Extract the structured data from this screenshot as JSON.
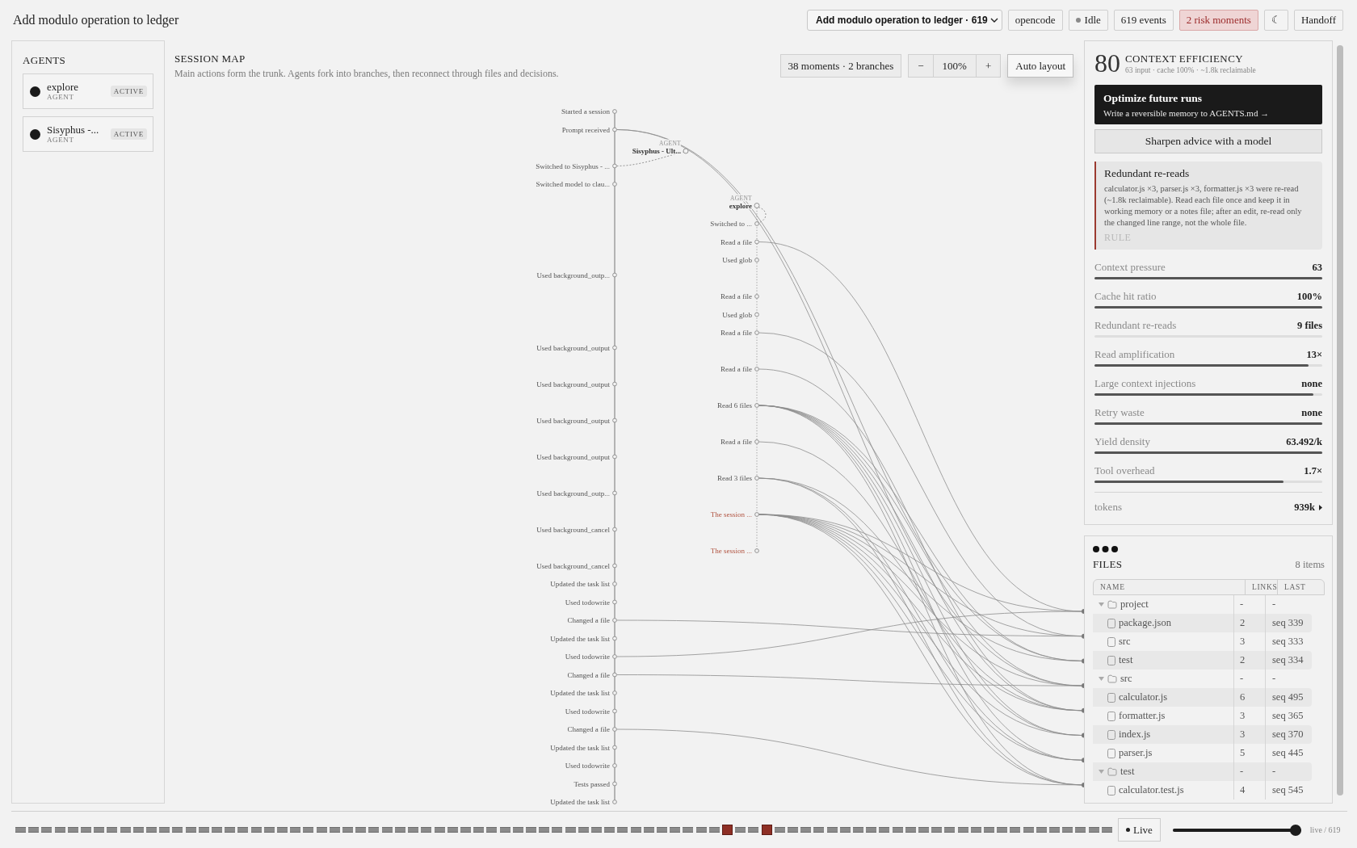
{
  "header": {
    "title": "Add modulo operation to ledger",
    "session_select": "Add modulo operation to ledger · 619",
    "buttons": [
      {
        "label": "opencode",
        "kind": "plain"
      },
      {
        "label": "Idle",
        "kind": "status"
      },
      {
        "label": "619 events",
        "kind": "plain"
      },
      {
        "label": "2 risk moments",
        "kind": "alert"
      },
      {
        "label": "☾",
        "kind": "plain"
      },
      {
        "label": "Handoff",
        "kind": "plain"
      }
    ]
  },
  "agents": {
    "title": "AGENTS",
    "items": [
      {
        "name": "explore",
        "role": "AGENT",
        "status": "ACTIVE"
      },
      {
        "name": "Sisyphus -...",
        "role": "AGENT",
        "status": "ACTIVE"
      }
    ]
  },
  "session_map": {
    "title": "SESSION MAP",
    "subtitle": "Main actions form the trunk. Agents fork into branches, then reconnect through files and decisions.",
    "summary": "38 moments · 2 branches",
    "zoom_out": "−",
    "zoom": "100%",
    "zoom_in": "+",
    "auto_layout": "Auto layout",
    "moments": [
      {
        "label": "Started a session",
        "kind": "step"
      },
      {
        "label": "Prompt received",
        "kind": "step"
      },
      {
        "label": "Sisyphus - Ult...",
        "kind": "agent",
        "caption": "AGENT"
      },
      {
        "label": "Switched to Sisyphus - ...",
        "kind": "step"
      },
      {
        "label": "Switched model to clau...",
        "kind": "step"
      },
      {
        "label": "explore",
        "kind": "agent",
        "caption": "AGENT"
      },
      {
        "label": "Switched to ...",
        "kind": "branch"
      },
      {
        "label": "Read a file",
        "kind": "branch"
      },
      {
        "label": "Used glob",
        "kind": "branch"
      },
      {
        "label": "Used background_outp...",
        "kind": "step"
      },
      {
        "label": "Read a file",
        "kind": "branch"
      },
      {
        "label": "Used glob",
        "kind": "branch"
      },
      {
        "label": "Read a file",
        "kind": "branch"
      },
      {
        "label": "Used background_output",
        "kind": "step"
      },
      {
        "label": "Read a file",
        "kind": "branch"
      },
      {
        "label": "Used background_output",
        "kind": "step"
      },
      {
        "label": "Read 6 files",
        "kind": "branch"
      },
      {
        "label": "Used background_output",
        "kind": "step"
      },
      {
        "label": "Read a file",
        "kind": "branch"
      },
      {
        "label": "Used background_output",
        "kind": "step"
      },
      {
        "label": "Read 3 files",
        "kind": "branch"
      },
      {
        "label": "Used background_outp...",
        "kind": "step"
      },
      {
        "label": "The session ...",
        "kind": "branch_alert"
      },
      {
        "label": "Used background_cancel",
        "kind": "step"
      },
      {
        "label": "The session ...",
        "kind": "branch_alert"
      },
      {
        "label": "Used background_cancel",
        "kind": "step"
      },
      {
        "label": "Updated the task list",
        "kind": "step"
      },
      {
        "label": "Used todowrite",
        "kind": "step"
      },
      {
        "label": "Changed a file",
        "kind": "step"
      },
      {
        "label": "Updated the task list",
        "kind": "step"
      },
      {
        "label": "Used todowrite",
        "kind": "step"
      },
      {
        "label": "Changed a file",
        "kind": "step"
      },
      {
        "label": "Updated the task list",
        "kind": "step"
      },
      {
        "label": "Used todowrite",
        "kind": "step"
      },
      {
        "label": "Changed a file",
        "kind": "step"
      },
      {
        "label": "Updated the task list",
        "kind": "step"
      },
      {
        "label": "Used todowrite",
        "kind": "step"
      },
      {
        "label": "Tests passed",
        "kind": "step"
      },
      {
        "label": "Updated the task list",
        "kind": "step"
      }
    ]
  },
  "context_efficiency": {
    "score": "80",
    "title": "CONTEXT EFFICIENCY",
    "summary": "63 input · cache 100% · ~1.8k reclaimable",
    "action": {
      "title": "Optimize future runs",
      "subtitle": "Write a reversible memory to AGENTS.md →"
    },
    "advice_button": "Sharpen advice with a model",
    "finding": {
      "title": "Redundant re-reads",
      "body": "calculator.js ×3, parser.js ×3, formatter.js ×3 were re-read (~1.8k reclaimable). Read each file once and keep it in working memory or a notes file; after an edit, re-read only the changed line range, not the whole file.",
      "tag": "RULE"
    },
    "metrics": [
      {
        "label": "Context pressure",
        "value": "63",
        "level": 1
      },
      {
        "label": "Cache hit ratio",
        "value": "100%",
        "level": 1
      },
      {
        "label": "Redundant re-reads",
        "value": "9 files",
        "level": 0
      },
      {
        "label": "Read amplification",
        "value": "13×",
        "level": 0.94
      },
      {
        "label": "Large context injections",
        "value": "none",
        "level": 0.96
      },
      {
        "label": "Retry waste",
        "value": "none",
        "level": 1
      },
      {
        "label": "Yield density",
        "value": "63.492/k",
        "level": 1
      },
      {
        "label": "Tool overhead",
        "value": "1.7×",
        "level": 0.83
      }
    ],
    "tokens": {
      "label": "tokens",
      "value": "939k"
    }
  },
  "files": {
    "title": "FILES",
    "count": "8 items",
    "columns": [
      "NAME",
      "LINKS",
      "LAST"
    ],
    "tree": [
      {
        "name": "project",
        "kind": "folder",
        "expanded": true,
        "links": "-",
        "last": "-",
        "children": [
          {
            "name": "package.json",
            "kind": "file",
            "links": "2",
            "last": "seq 339"
          },
          {
            "name": "src",
            "kind": "file",
            "links": "3",
            "last": "seq 333"
          },
          {
            "name": "test",
            "kind": "file",
            "links": "2",
            "last": "seq 334"
          }
        ]
      },
      {
        "name": "src",
        "kind": "folder",
        "expanded": true,
        "links": "-",
        "last": "-",
        "children": [
          {
            "name": "calculator.js",
            "kind": "file",
            "links": "6",
            "last": "seq 495"
          },
          {
            "name": "formatter.js",
            "kind": "file",
            "links": "3",
            "last": "seq 365"
          },
          {
            "name": "index.js",
            "kind": "file",
            "links": "3",
            "last": "seq 370"
          },
          {
            "name": "parser.js",
            "kind": "file",
            "links": "5",
            "last": "seq 445"
          }
        ]
      },
      {
        "name": "test",
        "kind": "folder",
        "expanded": true,
        "links": "-",
        "last": "-",
        "children": [
          {
            "name": "calculator.test.js",
            "kind": "file",
            "links": "4",
            "last": "seq 545"
          }
        ]
      }
    ]
  },
  "timeline": {
    "segments": [
      {
        "risk": false
      },
      {
        "risk": false
      },
      {
        "risk": false
      },
      {
        "risk": false
      },
      {
        "risk": false
      },
      {
        "risk": false
      },
      {
        "risk": false
      },
      {
        "risk": false
      },
      {
        "risk": false
      },
      {
        "risk": false
      },
      {
        "risk": false
      },
      {
        "risk": false
      },
      {
        "risk": false
      },
      {
        "risk": false
      },
      {
        "risk": false
      },
      {
        "risk": false
      },
      {
        "risk": false
      },
      {
        "risk": false
      },
      {
        "risk": false
      },
      {
        "risk": false
      },
      {
        "risk": false
      },
      {
        "risk": false
      },
      {
        "risk": false
      },
      {
        "risk": false
      },
      {
        "risk": false
      },
      {
        "risk": false
      },
      {
        "risk": false
      },
      {
        "risk": false
      },
      {
        "risk": false
      },
      {
        "risk": false
      },
      {
        "risk": false
      },
      {
        "risk": false
      },
      {
        "risk": false
      },
      {
        "risk": false
      },
      {
        "risk": false
      },
      {
        "risk": false
      },
      {
        "risk": false
      },
      {
        "risk": false
      },
      {
        "risk": false
      },
      {
        "risk": false
      },
      {
        "risk": false
      },
      {
        "risk": false
      },
      {
        "risk": false
      },
      {
        "risk": false
      },
      {
        "risk": false
      },
      {
        "risk": false
      },
      {
        "risk": false
      },
      {
        "risk": false
      },
      {
        "risk": false
      },
      {
        "risk": false
      },
      {
        "risk": false
      },
      {
        "risk": false
      },
      {
        "risk": false
      },
      {
        "risk": false
      },
      {
        "risk": true
      },
      {
        "risk": false
      },
      {
        "risk": false
      },
      {
        "risk": true
      },
      {
        "risk": false
      },
      {
        "risk": false
      },
      {
        "risk": false
      },
      {
        "risk": false
      },
      {
        "risk": false
      },
      {
        "risk": false
      },
      {
        "risk": false
      },
      {
        "risk": false
      },
      {
        "risk": false
      },
      {
        "risk": false
      },
      {
        "risk": false
      },
      {
        "risk": false
      },
      {
        "risk": false
      },
      {
        "risk": false
      },
      {
        "risk": false
      },
      {
        "risk": false
      },
      {
        "risk": false
      },
      {
        "risk": false
      },
      {
        "risk": false
      },
      {
        "risk": false
      },
      {
        "risk": false
      },
      {
        "risk": false
      },
      {
        "risk": false
      },
      {
        "risk": false
      },
      {
        "risk": false
      },
      {
        "risk": false
      }
    ],
    "live_button": "Live",
    "slider": {
      "level": 1
    },
    "position": "live / 619"
  }
}
